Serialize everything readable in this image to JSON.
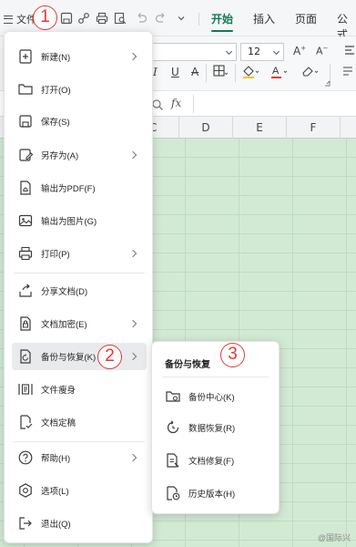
{
  "toolbar": {
    "file_label": "文件",
    "tabs": [
      {
        "label": "开始",
        "active": true
      },
      {
        "label": "插入",
        "active": false
      },
      {
        "label": "页面",
        "active": false
      },
      {
        "label": "公式",
        "active": false
      }
    ],
    "accent_color": "#157a52"
  },
  "ribbon": {
    "font_size": "12"
  },
  "formula_bar": {
    "fx_label": "fx"
  },
  "grid": {
    "columns": [
      "C",
      "D",
      "E",
      "F"
    ],
    "background_color": "#d2ead4"
  },
  "file_menu": {
    "items": [
      {
        "label": "新建(N)",
        "icon": "new-icon",
        "has_submenu": true
      },
      {
        "label": "打开(O)",
        "icon": "open-folder-icon",
        "has_submenu": false
      },
      {
        "label": "保存(S)",
        "icon": "save-icon",
        "has_submenu": false
      },
      {
        "label": "另存为(A)",
        "icon": "save-as-icon",
        "has_submenu": true
      },
      {
        "label": "输出为PDF(F)",
        "icon": "pdf-icon",
        "has_submenu": false
      },
      {
        "label": "输出为图片(G)",
        "icon": "image-icon",
        "has_submenu": false
      },
      {
        "label": "打印(P)",
        "icon": "print-icon",
        "has_submenu": true
      },
      {
        "label": "分享文档(D)",
        "icon": "share-icon",
        "has_submenu": false
      },
      {
        "label": "文档加密(E)",
        "icon": "lock-icon",
        "has_submenu": true
      },
      {
        "label": "备份与恢复(K)",
        "icon": "backup-icon",
        "has_submenu": true,
        "highlighted": true
      },
      {
        "label": "文件瘦身",
        "icon": "slim-icon",
        "has_submenu": false
      },
      {
        "label": "文档定稿",
        "icon": "finalize-icon",
        "has_submenu": false
      },
      {
        "label": "帮助(H)",
        "icon": "help-icon",
        "has_submenu": true
      },
      {
        "label": "选项(L)",
        "icon": "options-icon",
        "has_submenu": false
      },
      {
        "label": "退出(Q)",
        "icon": "exit-icon",
        "has_submenu": false
      }
    ]
  },
  "backup_submenu": {
    "title": "备份与恢复",
    "items": [
      {
        "label": "备份中心(K)",
        "icon": "backup-center-icon"
      },
      {
        "label": "数据恢复(R)",
        "icon": "data-recovery-icon"
      },
      {
        "label": "文档修复(F)",
        "icon": "doc-repair-icon"
      },
      {
        "label": "历史版本(H)",
        "icon": "history-icon"
      }
    ]
  },
  "annotations": [
    "1",
    "2",
    "3"
  ],
  "watermark": "@国际兴"
}
